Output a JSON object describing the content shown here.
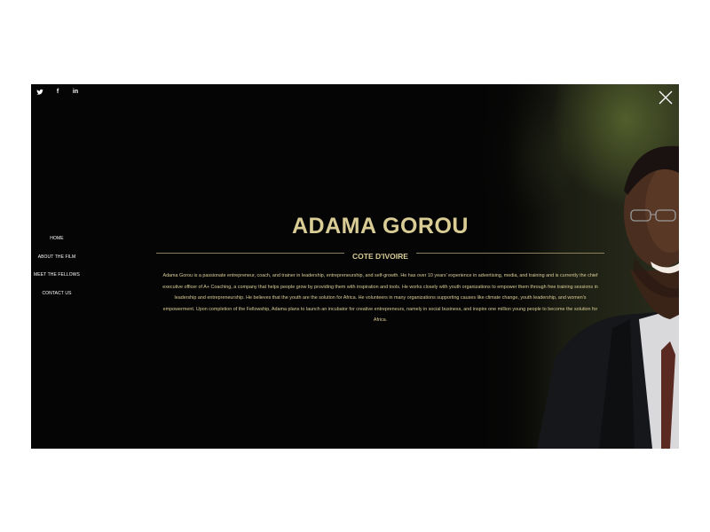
{
  "social": {
    "twitter": "🐦",
    "facebook": "f",
    "linkedin": "in"
  },
  "nav": {
    "items": [
      {
        "label": "HOME"
      },
      {
        "label": "ABOUT THE FILM"
      },
      {
        "label": "MEET THE FELLOWS"
      },
      {
        "label": "CONTACT US"
      }
    ]
  },
  "profile": {
    "name": "ADAMA GOROU",
    "country": "COTE D'IVOIRE",
    "bio": "Adama Gorou is a passionate entrepreneur, coach, and trainer in leadership, entrepreneurship, and self-growth. He has over 10 years' experience in advertising, media, and training and is currently the chief executive officer of A+ Coaching, a company that helps people grow by providing them with inspiration and tools. He works closely with youth organizations to empower them through free training sessions in leadership and entrepreneurship. He believes that the youth are the solution for Africa. He volunteers in many organizations supporting causes like climate change, youth leadership, and women's empowerment. Upon completion of the Fellowship, Adama plans to launch an incubator for creative entrepreneurs, namely in social business, and inspire one million young people to become the solution for Africa."
  },
  "colors": {
    "background": "#050505",
    "gold": "#d9cc95",
    "divider": "#8a815c",
    "nav_text": "#ffffff"
  },
  "icons": {
    "twitter": "twitter-icon",
    "facebook": "facebook-icon",
    "linkedin": "linkedin-icon",
    "close": "close-icon"
  }
}
